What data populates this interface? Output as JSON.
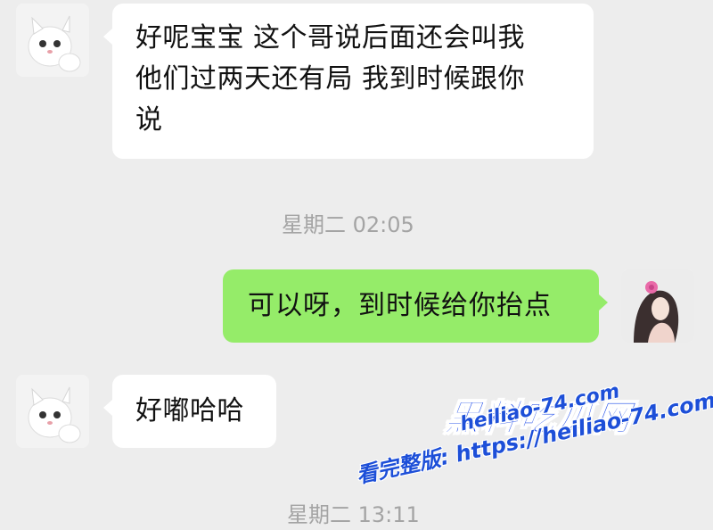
{
  "messages": [
    {
      "side": "left",
      "text": "好呢宝宝 这个哥说后面还会叫我\n他们过两天还有局 我到时候跟你\n说"
    },
    {
      "side": "right",
      "text": "可以呀，到时候给你抬点"
    },
    {
      "side": "left",
      "text": "好嘟哈哈"
    }
  ],
  "timestamps": [
    "星期二 02:05",
    "星期二 13:11"
  ],
  "watermark": {
    "brand": "黑料吃瓜网",
    "site": "heiliao-74.com",
    "full_version": "看完整版: https://heiliao-74.com"
  },
  "colors": {
    "background": "#ededed",
    "received_bubble": "#ffffff",
    "sent_bubble": "#95ec69",
    "timestamp": "#a4a4a4",
    "watermark": "#1d4fd8"
  },
  "icons": {
    "left_avatar": "white-kitten-avatar",
    "right_avatar": "girl-with-pink-flower-avatar"
  }
}
